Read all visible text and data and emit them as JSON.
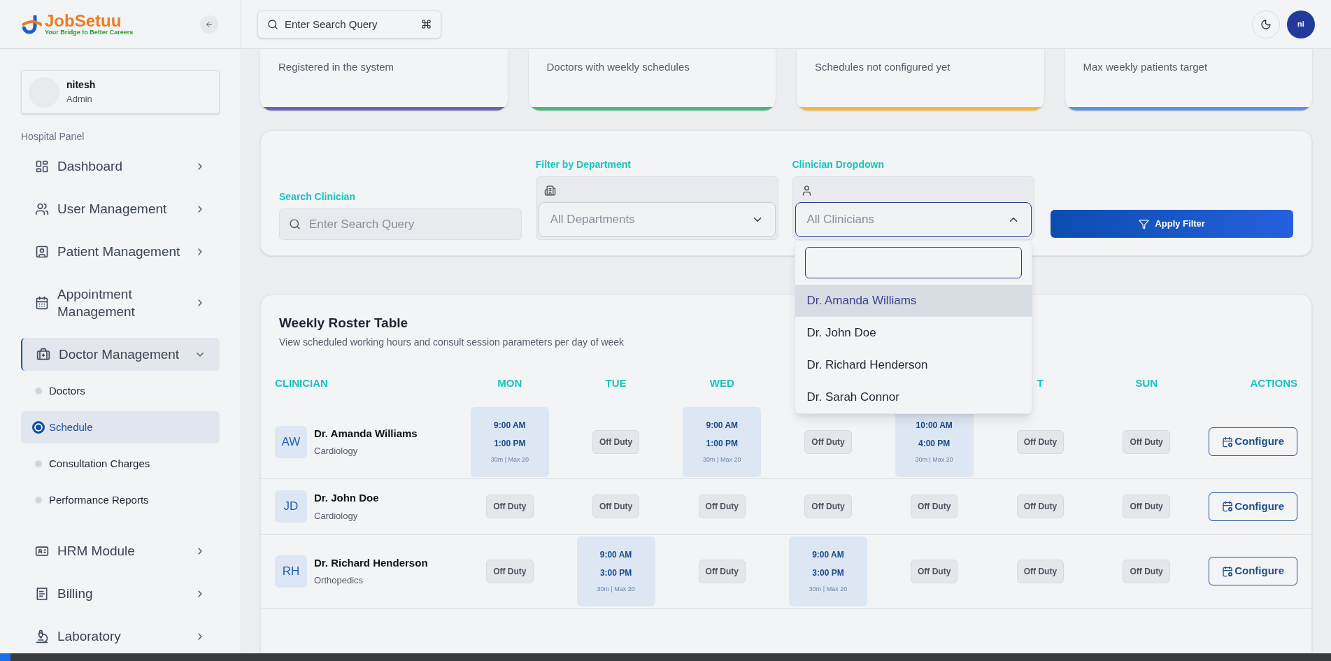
{
  "logo": {
    "name": "JobSetuu",
    "tagline": "Your Bridge to Better Careers"
  },
  "user": {
    "name": "nitesh",
    "role": "Admin"
  },
  "sidebar": {
    "section": "Hospital Panel",
    "items": [
      {
        "label": "Dashboard",
        "selected": false,
        "expanded": false
      },
      {
        "label": "User Management",
        "selected": false,
        "expanded": false
      },
      {
        "label": "Patient Management",
        "selected": false,
        "expanded": false
      },
      {
        "label": "Appointment Management",
        "selected": false,
        "expanded": false
      },
      {
        "label": "Doctor Management",
        "selected": true,
        "expanded": true,
        "children": [
          {
            "label": "Doctors",
            "selected": false
          },
          {
            "label": "Schedule",
            "selected": true
          },
          {
            "label": "Consultation Charges",
            "selected": false
          },
          {
            "label": "Performance Reports",
            "selected": false
          }
        ]
      },
      {
        "label": "HRM Module",
        "selected": false,
        "expanded": false
      },
      {
        "label": "Billing",
        "selected": false,
        "expanded": false
      },
      {
        "label": "Laboratory",
        "selected": false,
        "expanded": false
      }
    ]
  },
  "topbar": {
    "search_placeholder": "Enter Search Query",
    "avatar": "ni"
  },
  "stat_cards": [
    {
      "caption": "Registered in the system",
      "color": "#6b63b5"
    },
    {
      "caption": "Doctors with weekly schedules",
      "color": "#4cb877"
    },
    {
      "caption": "Schedules not configured yet",
      "color": "#f2b840"
    },
    {
      "caption": "Max weekly patients target",
      "color": "#5b93e0"
    }
  ],
  "filters": {
    "search": {
      "label": "Search Clinician",
      "placeholder": "Enter Search Query"
    },
    "department": {
      "label": "Filter by Department",
      "value": "All Departments"
    },
    "clinician": {
      "label": "Clinician Dropdown",
      "value": "All Clinicians",
      "expanded": true,
      "options": [
        {
          "label": "Dr. Amanda Williams",
          "selected": true
        },
        {
          "label": "Dr. John Doe",
          "selected": false
        },
        {
          "label": "Dr. Richard Henderson",
          "selected": false
        },
        {
          "label": "Dr. Sarah Connor",
          "selected": false
        }
      ]
    },
    "apply": "Apply Filter"
  },
  "roster": {
    "title": "Weekly Roster Table",
    "subtitle": "View scheduled working hours and consult session parameters per day of week",
    "columns": [
      {
        "label": "CLINICIAN"
      },
      {
        "label": "MON"
      },
      {
        "label": "TUE"
      },
      {
        "label": "WED"
      },
      {},
      {},
      {
        "label": "T"
      },
      {
        "label": "SUN"
      },
      {
        "label": "ACTIONS"
      }
    ],
    "rows": [
      {
        "initials": "AW",
        "name": "Dr. Amanda Williams",
        "department": "Cardiology",
        "action": "Configure",
        "days": [
          {
            "kind": "shift",
            "start": "9:00 AM",
            "end": "1:00 PM",
            "detail": "30m | Max 20"
          },
          {
            "kind": "off",
            "label": "Off Duty"
          },
          {
            "kind": "shift",
            "start": "9:00 AM",
            "end": "1:00 PM",
            "detail": "30m | Max 20"
          },
          {
            "kind": "off",
            "label": "Off Duty"
          },
          {
            "kind": "shift",
            "start": "10:00 AM",
            "end": "4:00 PM",
            "detail": "30m | Max 20"
          },
          {
            "kind": "off",
            "label": "Off Duty"
          },
          {
            "kind": "off",
            "label": "Off Duty"
          }
        ]
      },
      {
        "initials": "JD",
        "name": "Dr. John Doe",
        "department": "Cardiology",
        "action": "Configure",
        "days": [
          {
            "kind": "off",
            "label": "Off Duty"
          },
          {
            "kind": "off",
            "label": "Off Duty"
          },
          {
            "kind": "off",
            "label": "Off Duty"
          },
          {
            "kind": "off",
            "label": "Off Duty"
          },
          {
            "kind": "off",
            "label": "Off Duty"
          },
          {
            "kind": "off",
            "label": "Off Duty"
          },
          {
            "kind": "off",
            "label": "Off Duty"
          }
        ]
      },
      {
        "initials": "RH",
        "name": "Dr. Richard Henderson",
        "department": "Orthopedics",
        "action": "Configure",
        "days": [
          {
            "kind": "off",
            "label": "Off Duty"
          },
          {
            "kind": "shift",
            "start": "9:00 AM",
            "end": "3:00 PM",
            "detail": "30m | Max 20"
          },
          {
            "kind": "off",
            "label": "Off Duty"
          },
          {
            "kind": "shift",
            "start": "9:00 AM",
            "end": "3:00 PM",
            "detail": "30m | Max 20"
          },
          {
            "kind": "off",
            "label": "Off Duty"
          },
          {
            "kind": "off",
            "label": "Off Duty"
          },
          {
            "kind": "off",
            "label": "Off Duty"
          }
        ]
      }
    ]
  }
}
